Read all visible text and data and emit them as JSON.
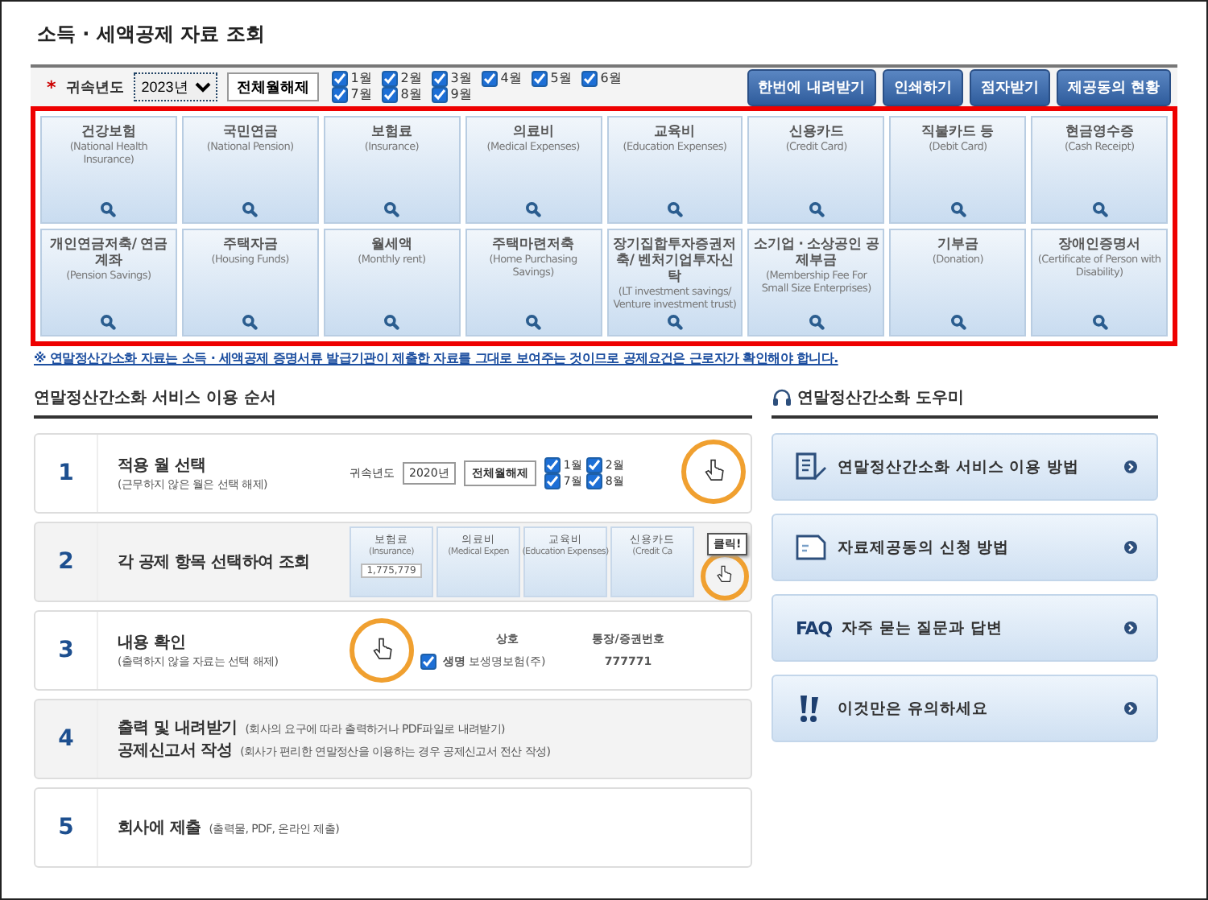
{
  "title": "소득 · 세액공제 자료 조회",
  "filter": {
    "required_mark": "*",
    "year_label": "귀속년도",
    "year_value": "2023년",
    "clear_button": "전체월해제",
    "months": [
      {
        "label": "1월",
        "checked": true
      },
      {
        "label": "2월",
        "checked": true
      },
      {
        "label": "3월",
        "checked": true
      },
      {
        "label": "4월",
        "checked": true
      },
      {
        "label": "5월",
        "checked": true
      },
      {
        "label": "6월",
        "checked": true
      },
      {
        "label": "7월",
        "checked": true
      },
      {
        "label": "8월",
        "checked": true
      },
      {
        "label": "9월",
        "checked": true
      }
    ],
    "buttons": [
      "한번에 내려받기",
      "인쇄하기",
      "점자받기",
      "제공동의 현황"
    ]
  },
  "categories": [
    {
      "title": "건강보험",
      "subtitle": "(National Health Insurance)"
    },
    {
      "title": "국민연금",
      "subtitle": "(National Pension)"
    },
    {
      "title": "보험료",
      "subtitle": "(Insurance)"
    },
    {
      "title": "의료비",
      "subtitle": "(Medical Expenses)"
    },
    {
      "title": "교육비",
      "subtitle": "(Education Expenses)"
    },
    {
      "title": "신용카드",
      "subtitle": "(Credit Card)"
    },
    {
      "title": "직불카드 등",
      "subtitle": "(Debit Card)"
    },
    {
      "title": "현금영수증",
      "subtitle": "(Cash Receipt)"
    },
    {
      "title": "개인연금저축/ 연금계좌",
      "subtitle": "(Pension Savings)"
    },
    {
      "title": "주택자금",
      "subtitle": "(Housing Funds)"
    },
    {
      "title": "월세액",
      "subtitle": "(Monthly rent)"
    },
    {
      "title": "주택마련저축",
      "subtitle": "(Home Purchasing Savings)"
    },
    {
      "title": "장기집합투자증권저축/ 벤처기업투자신탁",
      "subtitle": "(LT investment savings/ Venture investment trust)"
    },
    {
      "title": "소기업 · 소상공인 공제부금",
      "subtitle": "(Membership Fee For Small Size Enterprises)"
    },
    {
      "title": "기부금",
      "subtitle": "(Donation)"
    },
    {
      "title": "장애인증명서",
      "subtitle": "(Certificate of Person with Disability)"
    }
  ],
  "notice": "※ 연말정산간소화 자료는 소득 · 세액공제 증명서류 발급기관이 제출한 자료를 그대로 보여주는 것이므로 공제요건은 근로자가 확인해야 합니다.",
  "steps_section": {
    "heading": "연말정산간소화 서비스 이용 순서",
    "steps": [
      {
        "number": "1",
        "kind": "stacked",
        "lines": [
          {
            "title": "적용 월 선택",
            "note": "(근무하지 않은 월은 선택 해제)"
          }
        ],
        "illustration": {
          "kind": "year-filter",
          "year_label": "귀속년도",
          "year_value": "2020년",
          "clear_button": "전체월해제",
          "months": [
            {
              "label": "1월",
              "checked": true
            },
            {
              "label": "2월",
              "checked": true
            },
            {
              "label": "7월",
              "checked": true
            },
            {
              "label": "8월",
              "checked": true
            }
          ]
        }
      },
      {
        "number": "2",
        "kind": "stacked",
        "lines": [
          {
            "title": "각 공제 항목 선택하여 조회"
          }
        ],
        "illustration": {
          "kind": "tiles",
          "callout": "클릭!",
          "tiles": [
            {
              "title": "보험료",
              "subtitle": "(Insurance)",
              "amount": "1,775,779"
            },
            {
              "title": "의료비",
              "subtitle": "(Medical Expen"
            },
            {
              "title": "교육비",
              "subtitle": "(Education Expenses)"
            },
            {
              "title": "신용카드",
              "subtitle": "(Credit Ca"
            }
          ]
        }
      },
      {
        "number": "3",
        "kind": "stacked",
        "lines": [
          {
            "title": "내용 확인",
            "note": "(출력하지 않을 자료는 선택 해제)"
          }
        ],
        "illustration": {
          "kind": "table",
          "columns": [
            "상호",
            "통장/증권번호"
          ],
          "rows": [
            {
              "checked": true,
              "name": "생명",
              "company": "보생명보험(주)",
              "number": "777771"
            }
          ]
        }
      },
      {
        "number": "4",
        "kind": "inline",
        "lines": [
          {
            "title": "출력 및 내려받기",
            "note": "(회사의 요구에 따라 출력하거나 PDF파일로 내려받기)"
          },
          {
            "title": "공제신고서 작성",
            "note": "(회사가 편리한 연말정산을 이용하는 경우 공제신고서 전산 작성)"
          }
        ]
      },
      {
        "number": "5",
        "kind": "inline",
        "lines": [
          {
            "title": "회사에 제출",
            "note": "(출력물, PDF, 온라인 제출)"
          }
        ]
      }
    ]
  },
  "helper_section": {
    "heading": "연말정산간소화 도우미",
    "items": [
      {
        "kind": "document",
        "label": "연말정산간소화 서비스 이용 방법"
      },
      {
        "kind": "file",
        "label": "자료제공동의 신청 방법"
      },
      {
        "kind": "faq",
        "icon_text": "FAQ",
        "label": "자주 묻는 질문과 답변"
      },
      {
        "kind": "alert",
        "label": "이것만은 유의하세요"
      }
    ]
  }
}
